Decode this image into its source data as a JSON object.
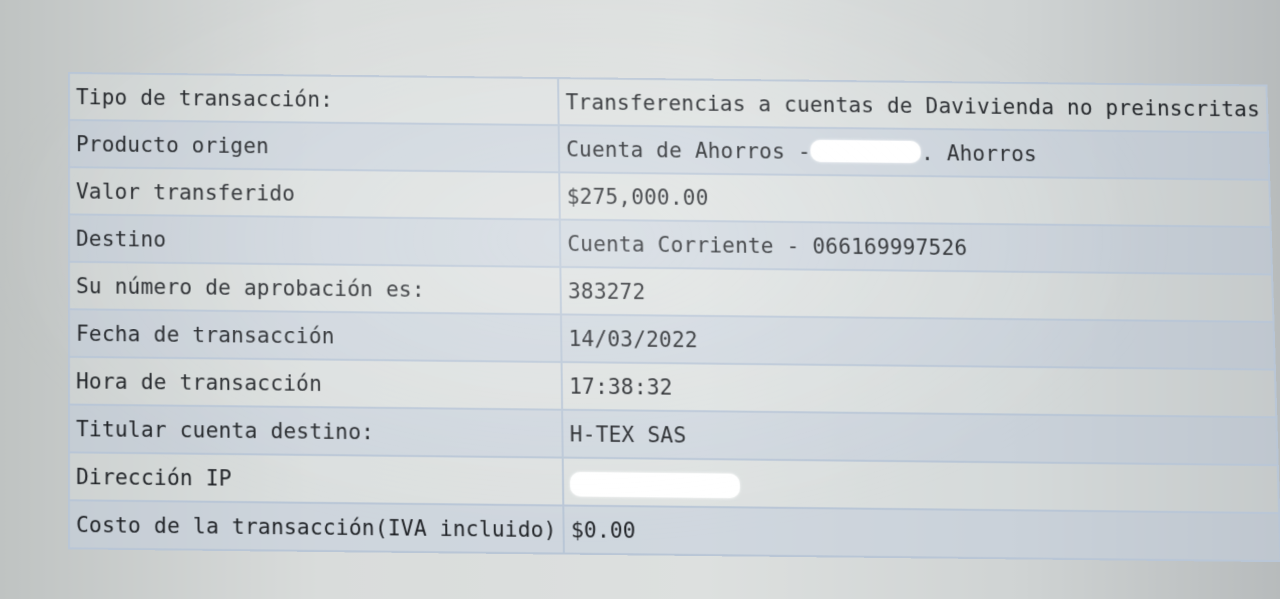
{
  "receipt": {
    "rows": [
      {
        "label": "Tipo de transacción:",
        "value": "Transferencias a cuentas de Davivienda no preinscritas"
      },
      {
        "label": "Producto origen",
        "value_prefix": "Cuenta de Ahorros -",
        "value_suffix": ". Ahorros"
      },
      {
        "label": "Valor transferido",
        "value": "$275,000.00"
      },
      {
        "label": "Destino",
        "value": "Cuenta Corriente - 066169997526"
      },
      {
        "label": "Su número de aprobación es:",
        "value": "383272"
      },
      {
        "label": "Fecha de transacción",
        "value": "14/03/2022"
      },
      {
        "label": "Hora de transacción",
        "value": "17:38:32"
      },
      {
        "label": "Titular cuenta destino:",
        "value": "H-TEX SAS"
      },
      {
        "label": "Dirección IP"
      },
      {
        "label": "Costo de la transacción(IVA incluido)",
        "value": "$0.00"
      }
    ]
  }
}
